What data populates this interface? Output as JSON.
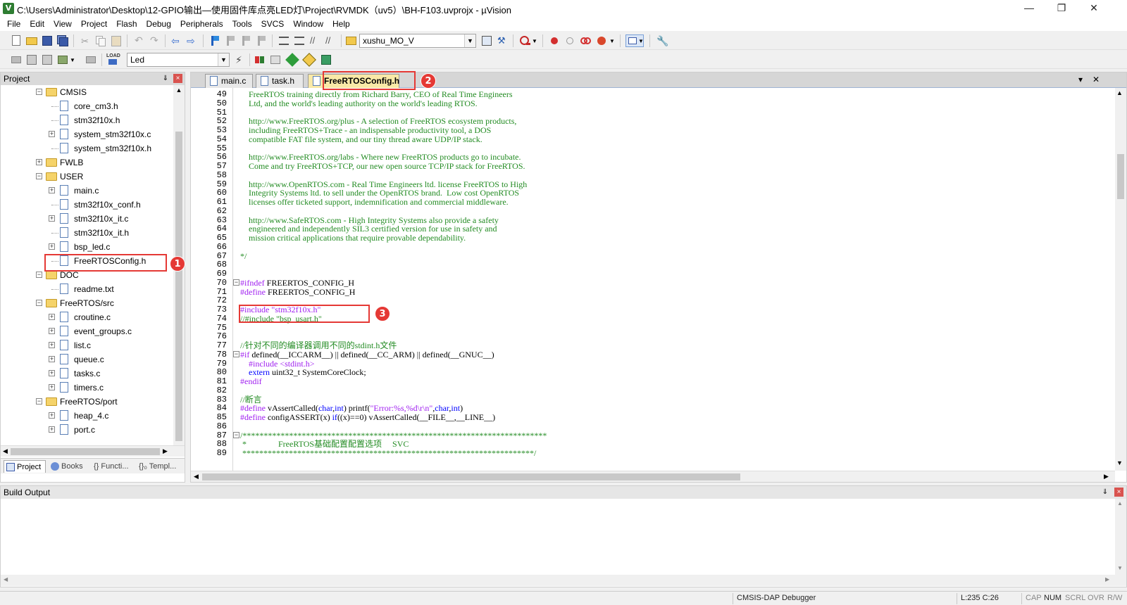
{
  "window": {
    "title": "C:\\Users\\Administrator\\Desktop\\12-GPIO输出—使用固件库点亮LED灯\\Project\\RVMDK（uv5）\\BH-F103.uvprojx - µVision",
    "minimize": "—",
    "maximize": "❐",
    "close": "✕"
  },
  "menu": [
    "File",
    "Edit",
    "View",
    "Project",
    "Flash",
    "Debug",
    "Peripherals",
    "Tools",
    "SVCS",
    "Window",
    "Help"
  ],
  "toolbar": {
    "target_combo": "xushu_MO_V",
    "build_combo": "Led",
    "load_label": "LOAD"
  },
  "project_panel": {
    "title": "Project",
    "pin": "⇓",
    "close": "×",
    "tree": [
      {
        "label": "CMSIS",
        "type": "folder",
        "level": 1,
        "expander": "−"
      },
      {
        "label": "core_cm3.h",
        "type": "file",
        "level": 2,
        "expander": ""
      },
      {
        "label": "stm32f10x.h",
        "type": "file",
        "level": 2,
        "expander": ""
      },
      {
        "label": "system_stm32f10x.c",
        "type": "file",
        "level": 2,
        "expander": "+"
      },
      {
        "label": "system_stm32f10x.h",
        "type": "file",
        "level": 2,
        "expander": ""
      },
      {
        "label": "FWLB",
        "type": "folder",
        "level": 1,
        "expander": "+"
      },
      {
        "label": "USER",
        "type": "folder",
        "level": 1,
        "expander": "−"
      },
      {
        "label": "main.c",
        "type": "file",
        "level": 2,
        "expander": "+"
      },
      {
        "label": "stm32f10x_conf.h",
        "type": "file",
        "level": 2,
        "expander": ""
      },
      {
        "label": "stm32f10x_it.c",
        "type": "file",
        "level": 2,
        "expander": "+"
      },
      {
        "label": "stm32f10x_it.h",
        "type": "file",
        "level": 2,
        "expander": ""
      },
      {
        "label": "bsp_led.c",
        "type": "file",
        "level": 2,
        "expander": "+"
      },
      {
        "label": "FreeRTOSConfig.h",
        "type": "file",
        "level": 2,
        "expander": ""
      },
      {
        "label": "DOC",
        "type": "folder",
        "level": 1,
        "expander": "−"
      },
      {
        "label": "readme.txt",
        "type": "file",
        "level": 2,
        "expander": ""
      },
      {
        "label": "FreeRTOS/src",
        "type": "folder",
        "level": 1,
        "expander": "−"
      },
      {
        "label": "croutine.c",
        "type": "file",
        "level": 2,
        "expander": "+"
      },
      {
        "label": "event_groups.c",
        "type": "file",
        "level": 2,
        "expander": "+"
      },
      {
        "label": "list.c",
        "type": "file",
        "level": 2,
        "expander": "+"
      },
      {
        "label": "queue.c",
        "type": "file",
        "level": 2,
        "expander": "+"
      },
      {
        "label": "tasks.c",
        "type": "file",
        "level": 2,
        "expander": "+"
      },
      {
        "label": "timers.c",
        "type": "file",
        "level": 2,
        "expander": "+"
      },
      {
        "label": "FreeRTOS/port",
        "type": "folder",
        "level": 1,
        "expander": "−"
      },
      {
        "label": "heap_4.c",
        "type": "file",
        "level": 2,
        "expander": "+"
      },
      {
        "label": "port.c",
        "type": "file",
        "level": 2,
        "expander": "+"
      }
    ],
    "tabs": [
      "Project",
      "Books",
      "{} Functi...",
      "{}₀ Templ..."
    ]
  },
  "editor": {
    "tabs": [
      "main.c",
      "task.h",
      "FreeRTOSConfig.h"
    ],
    "active_tab": 2,
    "dropdown": "▾",
    "close": "✕",
    "lines": [
      {
        "n": "49",
        "segs": [
          [
            "c",
            "    FreeRTOS training directly from Richard Barry, CEO of Real Time Engineers"
          ]
        ]
      },
      {
        "n": "50",
        "segs": [
          [
            "c",
            "    Ltd, and the world's leading authority on the world's leading RTOS."
          ]
        ]
      },
      {
        "n": "51",
        "segs": []
      },
      {
        "n": "52",
        "segs": [
          [
            "c",
            "    http://www.FreeRTOS.org/plus - A selection of FreeRTOS ecosystem products,"
          ]
        ]
      },
      {
        "n": "53",
        "segs": [
          [
            "c",
            "    including FreeRTOS+Trace - an indispensable productivity tool, a DOS"
          ]
        ]
      },
      {
        "n": "54",
        "segs": [
          [
            "c",
            "    compatible FAT file system, and our tiny thread aware UDP/IP stack."
          ]
        ]
      },
      {
        "n": "55",
        "segs": []
      },
      {
        "n": "56",
        "segs": [
          [
            "c",
            "    http://www.FreeRTOS.org/labs - Where new FreeRTOS products go to incubate."
          ]
        ]
      },
      {
        "n": "57",
        "segs": [
          [
            "c",
            "    Come and try FreeRTOS+TCP, our new open source TCP/IP stack for FreeRTOS."
          ]
        ]
      },
      {
        "n": "58",
        "segs": []
      },
      {
        "n": "59",
        "segs": [
          [
            "c",
            "    http://www.OpenRTOS.com - Real Time Engineers ltd. license FreeRTOS to High"
          ]
        ]
      },
      {
        "n": "60",
        "segs": [
          [
            "c",
            "    Integrity Systems ltd. to sell under the OpenRTOS brand.  Low cost OpenRTOS"
          ]
        ]
      },
      {
        "n": "61",
        "segs": [
          [
            "c",
            "    licenses offer ticketed support, indemnification and commercial middleware."
          ]
        ]
      },
      {
        "n": "62",
        "segs": []
      },
      {
        "n": "63",
        "segs": [
          [
            "c",
            "    http://www.SafeRTOS.com - High Integrity Systems also provide a safety"
          ]
        ]
      },
      {
        "n": "64",
        "segs": [
          [
            "c",
            "    engineered and independently SIL3 certified version for use in safety and"
          ]
        ]
      },
      {
        "n": "65",
        "segs": [
          [
            "c",
            "    mission critical applications that require provable dependability."
          ]
        ]
      },
      {
        "n": "66",
        "segs": []
      },
      {
        "n": "67",
        "segs": [
          [
            "c",
            "*/"
          ]
        ]
      },
      {
        "n": "68",
        "segs": []
      },
      {
        "n": "69",
        "segs": []
      },
      {
        "n": "70",
        "segs": [
          [
            "p",
            "#ifndef"
          ],
          [
            "t",
            " FREERTOS_CONFIG_H"
          ]
        ]
      },
      {
        "n": "71",
        "segs": [
          [
            "p",
            "#define"
          ],
          [
            "t",
            " FREERTOS_CONFIG_H"
          ]
        ]
      },
      {
        "n": "72",
        "segs": []
      },
      {
        "n": "73",
        "segs": [
          [
            "p",
            "#include"
          ],
          [
            "t",
            " "
          ],
          [
            "s",
            "\"stm32f10x.h\""
          ]
        ]
      },
      {
        "n": "74",
        "segs": [
          [
            "c",
            "//#include \"bsp_usart.h\""
          ]
        ]
      },
      {
        "n": "75",
        "segs": []
      },
      {
        "n": "76",
        "segs": []
      },
      {
        "n": "77",
        "segs": [
          [
            "c",
            "//针对不同的编译器调用不同的stdint.h文件"
          ]
        ]
      },
      {
        "n": "78",
        "segs": [
          [
            "p",
            "#if"
          ],
          [
            "t",
            " defined(__ICCARM__) || defined(__CC_ARM) || defined(__GNUC__)"
          ]
        ]
      },
      {
        "n": "79",
        "segs": [
          [
            "t",
            "    "
          ],
          [
            "p",
            "#include"
          ],
          [
            "t",
            " "
          ],
          [
            "s",
            "<stdint.h>"
          ]
        ]
      },
      {
        "n": "80",
        "segs": [
          [
            "t",
            "    "
          ],
          [
            "k",
            "extern"
          ],
          [
            "t",
            " uint32_t SystemCoreClock;"
          ]
        ]
      },
      {
        "n": "81",
        "segs": [
          [
            "p",
            "#endif"
          ]
        ]
      },
      {
        "n": "82",
        "segs": []
      },
      {
        "n": "83",
        "segs": [
          [
            "c",
            "//断言"
          ]
        ]
      },
      {
        "n": "84",
        "segs": [
          [
            "p",
            "#define"
          ],
          [
            "t",
            " vAssertCalled("
          ],
          [
            "k",
            "char"
          ],
          [
            "t",
            ","
          ],
          [
            "k",
            "int"
          ],
          [
            "t",
            ") printf("
          ],
          [
            "s",
            "\"Error:%s,%d\\r\\n\""
          ],
          [
            "t",
            ","
          ],
          [
            "k",
            "char"
          ],
          [
            "t",
            ","
          ],
          [
            "k",
            "int"
          ],
          [
            "t",
            ")"
          ]
        ]
      },
      {
        "n": "85",
        "segs": [
          [
            "p",
            "#define"
          ],
          [
            "t",
            " configASSERT(x) "
          ],
          [
            "k",
            "if"
          ],
          [
            "t",
            "((x)==0) vAssertCalled(__FILE__,__LINE__)"
          ]
        ]
      },
      {
        "n": "86",
        "segs": []
      },
      {
        "n": "87",
        "segs": [
          [
            "c",
            "/************************************************************************"
          ]
        ]
      },
      {
        "n": "88",
        "segs": [
          [
            "c",
            " *               FreeRTOS基础配置配置选项     SVC"
          ]
        ]
      },
      {
        "n": "89",
        "segs": [
          [
            "c",
            " *********************************************************************/"
          ]
        ]
      }
    ]
  },
  "build_output": {
    "title": "Build Output"
  },
  "statusbar": {
    "debugger": "CMSIS-DAP Debugger",
    "position": "L:235 C:26",
    "cap": "CAP",
    "num": "NUM",
    "scrl": "SCRL",
    "ovr": "OVR",
    "rw": "R/W"
  },
  "annotations": [
    "1",
    "2",
    "3"
  ],
  "colors": {
    "highlight": "#e53935",
    "comment": "#228b22",
    "preprocessor": "#a020f0",
    "keyword": "#0000ff",
    "active_tab": "#f9e9a7"
  }
}
